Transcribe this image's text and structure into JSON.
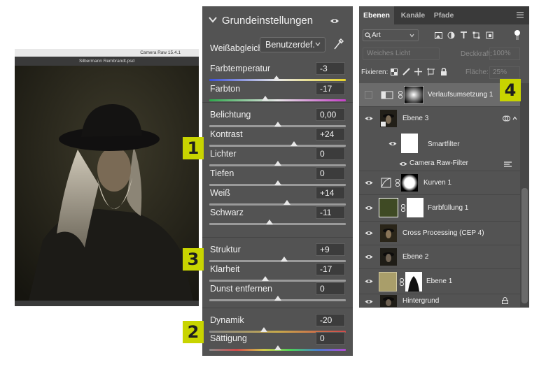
{
  "preview": {
    "app_title": "Camera Raw 15.4.1",
    "file_name": "Silbermann Rembrandt.psd"
  },
  "basic_panel": {
    "title": "Grundeinstellungen",
    "white_balance": {
      "label": "Weißabgleich",
      "value": "Benutzerdef."
    },
    "groups": [
      [
        {
          "label": "Farbtemperatur",
          "value": "-3",
          "level": 0.49,
          "track": "temperature"
        },
        {
          "label": "Farbton",
          "value": "-17",
          "level": 0.41,
          "track": "tint"
        }
      ],
      [
        {
          "label": "Belichtung",
          "value": "0,00",
          "level": 0.5,
          "track": "gray"
        },
        {
          "label": "Kontrast",
          "value": "+24",
          "level": 0.62,
          "track": "gray"
        },
        {
          "label": "Lichter",
          "value": "0",
          "level": 0.5,
          "track": "gray"
        },
        {
          "label": "Tiefen",
          "value": "0",
          "level": 0.5,
          "track": "gray"
        },
        {
          "label": "Weiß",
          "value": "+14",
          "level": 0.57,
          "track": "gray"
        },
        {
          "label": "Schwarz",
          "value": "-11",
          "level": 0.44,
          "track": "gray"
        }
      ],
      [
        {
          "label": "Struktur",
          "value": "+9",
          "level": 0.55,
          "track": "gray"
        },
        {
          "label": "Klarheit",
          "value": "-17",
          "level": 0.41,
          "track": "gray"
        },
        {
          "label": "Dunst entfernen",
          "value": "0",
          "level": 0.5,
          "track": "gray"
        }
      ],
      [
        {
          "label": "Dynamik",
          "value": "-20",
          "level": 0.4,
          "track": "vibrance"
        },
        {
          "label": "Sättigung",
          "value": "0",
          "level": 0.5,
          "track": "saturation"
        }
      ]
    ]
  },
  "layers_panel": {
    "tabs": [
      {
        "label": "Ebenen",
        "active": true
      },
      {
        "label": "Kanäle",
        "active": false
      },
      {
        "label": "Pfade",
        "active": false
      }
    ],
    "filter_kind": "Art",
    "blend_mode": "Weiches Licht",
    "opacity_label": "Deckkraft:",
    "opacity_value": "100%",
    "lock_label": "Fixieren:",
    "fill_label": "Fläche:",
    "fill_value": "25%",
    "layers": [
      {
        "name": "Verlaufsumsetzung 1",
        "visible": false,
        "selected": true
      },
      {
        "name": "Ebene 3",
        "visible": true
      },
      {
        "name": "Smartfilter",
        "visible": true,
        "sub": true
      },
      {
        "name": "Camera Raw-Filter",
        "visible": true,
        "sub": true
      },
      {
        "name": "Kurven 1",
        "visible": true
      },
      {
        "name": "Farbfüllung 1",
        "visible": true
      },
      {
        "name": "Cross Processing (CEP 4)",
        "visible": true
      },
      {
        "name": "Ebene 2",
        "visible": true
      },
      {
        "name": "Ebene 1",
        "visible": true
      },
      {
        "name": "Hintergrund",
        "visible": true,
        "locked": true
      }
    ]
  },
  "badges": [
    "1",
    "2",
    "3",
    "4"
  ],
  "colors": {
    "accent_badge": "#c8d400",
    "panel_bg": "#535353",
    "panel_dark": "#3a3a3a"
  }
}
